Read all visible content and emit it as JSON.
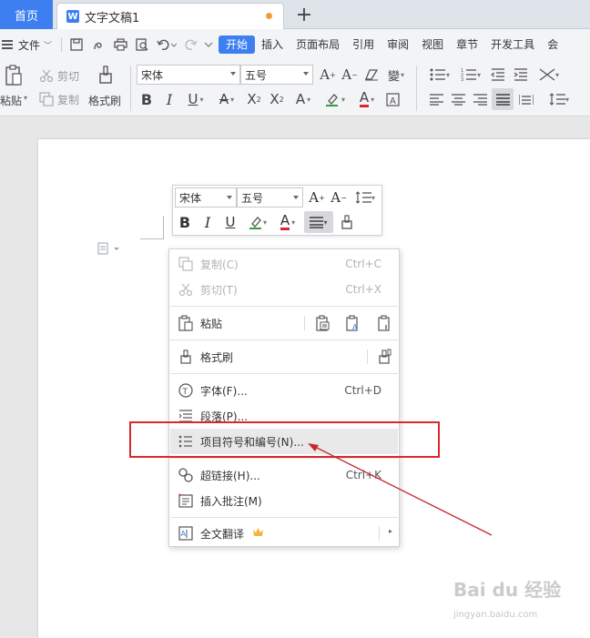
{
  "tabs": {
    "home": "首页",
    "doc_title": "文字文稿1",
    "doc_icon_letter": "W",
    "add": "+"
  },
  "menubar": {
    "file": "文件",
    "tabs": [
      "开始",
      "插入",
      "页面布局",
      "引用",
      "审阅",
      "视图",
      "章节",
      "开发工具",
      "会"
    ]
  },
  "ribbon": {
    "paste": "粘贴",
    "cut": "剪切",
    "copy": "复制",
    "format_painter": "格式刷",
    "font_name": "宋体",
    "font_size": "五号",
    "font_color_accent": "#d9282f",
    "highlight_accent": "#2ea043"
  },
  "mini_toolbar": {
    "font_name": "宋体",
    "font_size": "五号"
  },
  "context_menu": {
    "items": [
      {
        "label": "复制(C)",
        "shortcut": "Ctrl+C"
      },
      {
        "label": "剪切(T)",
        "shortcut": "Ctrl+X"
      },
      {
        "label": "粘贴",
        "shortcut": ""
      },
      {
        "label": "格式刷",
        "shortcut": ""
      },
      {
        "label": "字体(F)...",
        "shortcut": "Ctrl+D"
      },
      {
        "label": "段落(P)...",
        "shortcut": ""
      },
      {
        "label": "项目符号和编号(N)...",
        "shortcut": ""
      },
      {
        "label": "超链接(H)...",
        "shortcut": "Ctrl+K"
      },
      {
        "label": "插入批注(M)",
        "shortcut": ""
      },
      {
        "label": "全文翻译",
        "shortcut": ""
      }
    ]
  },
  "watermark": {
    "main": "Bai du 经验",
    "sub": "jingyan.baidu.com"
  }
}
